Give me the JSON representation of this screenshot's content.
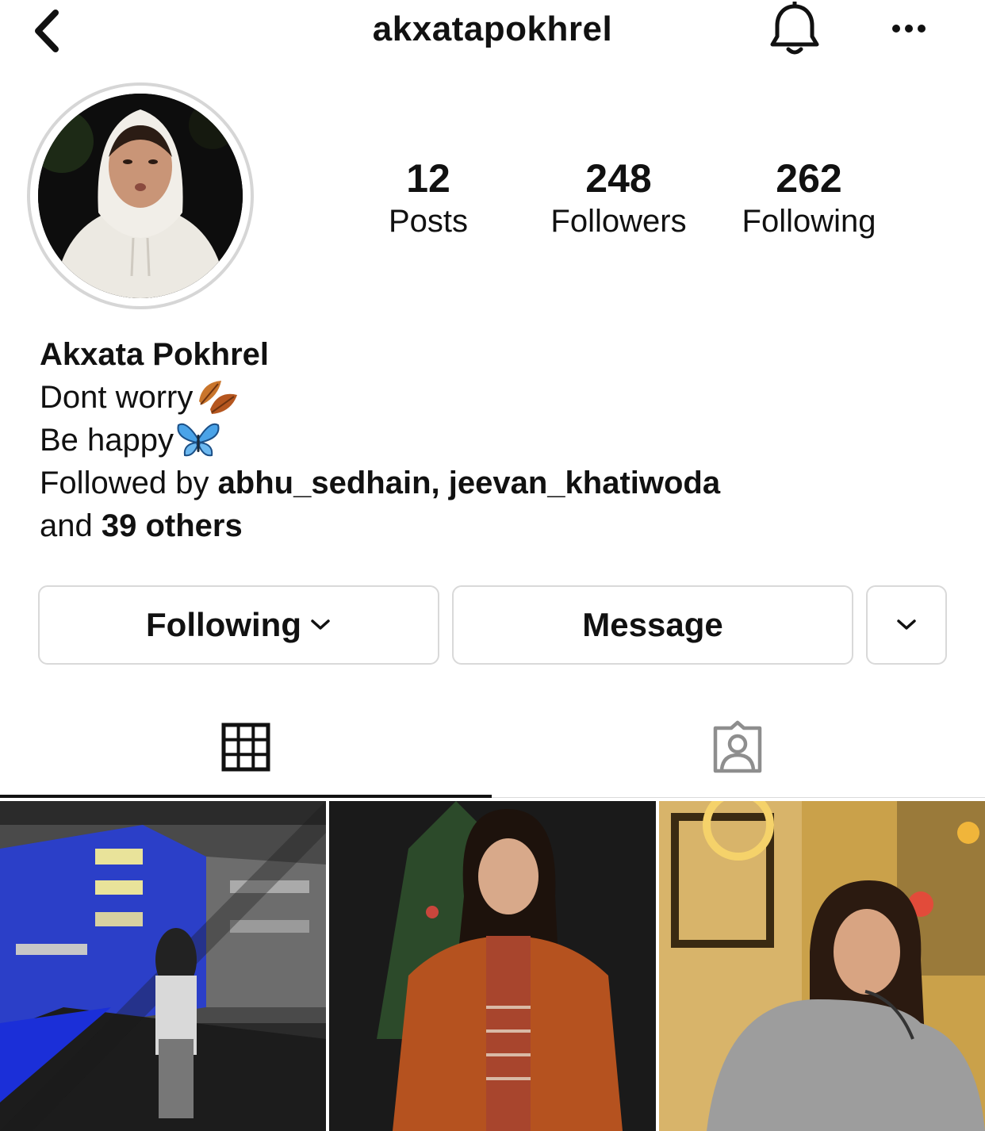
{
  "header": {
    "username": "akxatapokhrel",
    "back_icon": "chevron-left-icon",
    "notifications_icon": "bell-icon",
    "more_icon": "more-horizontal-icon"
  },
  "profile": {
    "avatar": "profile-photo",
    "stats": [
      {
        "value": "12",
        "label": "Posts"
      },
      {
        "value": "248",
        "label": "Followers"
      },
      {
        "value": "262",
        "label": "Following"
      }
    ],
    "display_name": "Akxata Pokhrel",
    "bio_line_1": "Dont worry",
    "bio_line_1_emoji": "fallen-leaf",
    "bio_line_2": "Be happy",
    "bio_line_2_emoji": "butterfly",
    "followed_by_prefix": "Followed by ",
    "followed_by_users": "abhu_sedhain, jeevan_khatiwoda",
    "followed_by_and": "and ",
    "followed_by_others": "39 others"
  },
  "actions": {
    "following_label": "Following",
    "message_label": "Message"
  },
  "tabs": [
    {
      "name": "grid",
      "icon": "grid-icon",
      "active": true
    },
    {
      "name": "tagged",
      "icon": "tagged-person-icon",
      "active": false
    }
  ],
  "posts": [
    {
      "description": "night-building-photo"
    },
    {
      "description": "orange-jacket-photo"
    },
    {
      "description": "cafe-photo"
    }
  ]
}
